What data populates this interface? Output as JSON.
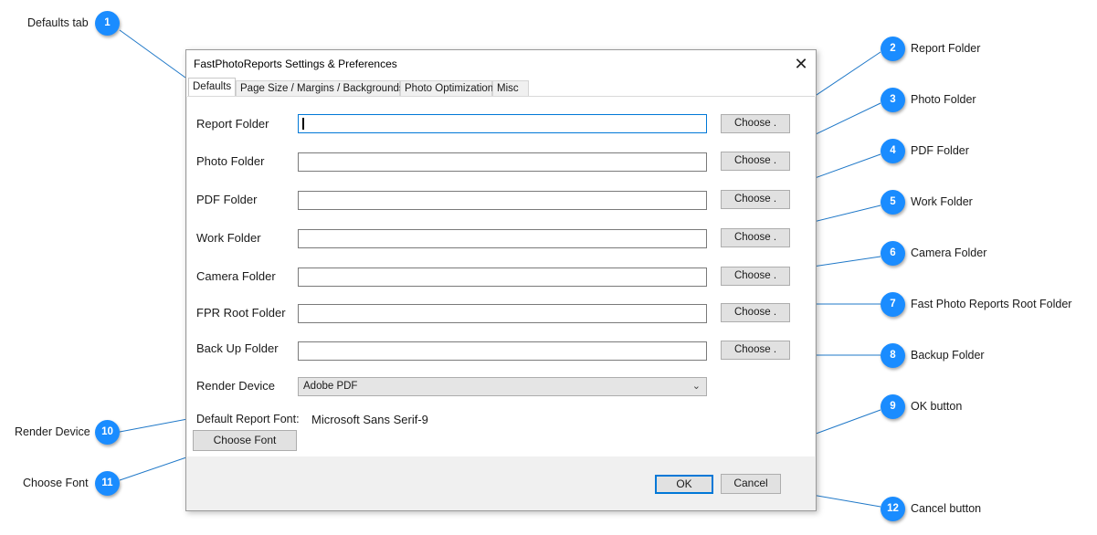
{
  "dialog": {
    "title": "FastPhotoReports Settings & Preferences",
    "close_glyph": "✕",
    "tabs": [
      {
        "label": "Defaults"
      },
      {
        "label": "Page Size / Margins / Backgrounds"
      },
      {
        "label": "Photo Optimization"
      },
      {
        "label": "Misc"
      }
    ],
    "fields": [
      {
        "label": "Report Folder",
        "value": "",
        "button": "Choose ."
      },
      {
        "label": "Photo Folder",
        "value": "",
        "button": "Choose ."
      },
      {
        "label": "PDF Folder",
        "value": "",
        "button": "Choose ."
      },
      {
        "label": "Work Folder",
        "value": "",
        "button": "Choose ."
      },
      {
        "label": "Camera Folder",
        "value": "",
        "button": "Choose ."
      },
      {
        "label": "FPR Root Folder",
        "value": "",
        "button": "Choose ."
      },
      {
        "label": "Back Up Folder",
        "value": "",
        "button": "Choose ."
      }
    ],
    "render_device": {
      "label": "Render Device",
      "selected": "Adobe PDF",
      "chevron": "⌄"
    },
    "default_font": {
      "label": "Default Report Font:",
      "value": "Microsoft Sans Serif-9",
      "button": "Choose Font"
    },
    "ok_label": "OK",
    "cancel_label": "Cancel"
  },
  "annotations": [
    {
      "num": "1",
      "label": "Defaults tab"
    },
    {
      "num": "2",
      "label": "Report Folder"
    },
    {
      "num": "3",
      "label": "Photo Folder"
    },
    {
      "num": "4",
      "label": "PDF Folder"
    },
    {
      "num": "5",
      "label": "Work Folder"
    },
    {
      "num": "6",
      "label": "Camera Folder"
    },
    {
      "num": "7",
      "label": "Fast Photo Reports Root Folder"
    },
    {
      "num": "8",
      "label": "Backup Folder"
    },
    {
      "num": "9",
      "label": "OK button"
    },
    {
      "num": "10",
      "label": "Render Device"
    },
    {
      "num": "11",
      "label": "Choose Font"
    },
    {
      "num": "12",
      "label": "Cancel button"
    }
  ],
  "colors": {
    "badge": "#1a8cff",
    "focus_border": "#0078d7",
    "callout_line": "#1f78c8"
  }
}
